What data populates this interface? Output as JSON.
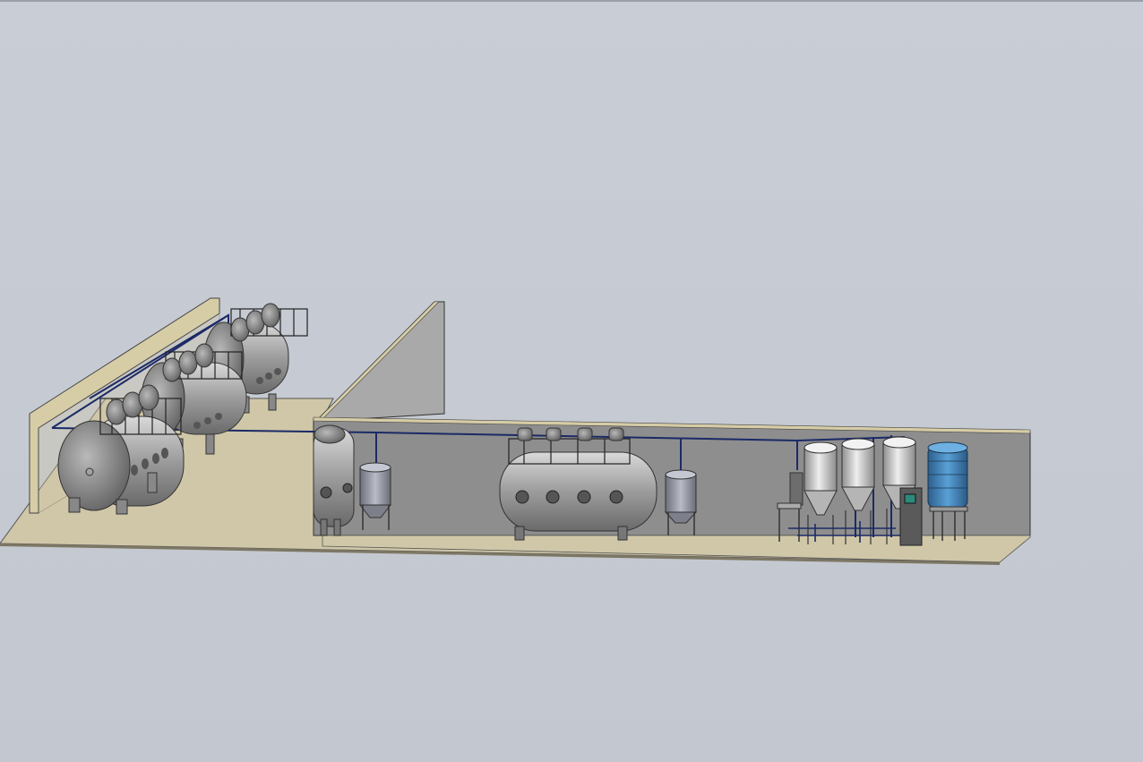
{
  "viewport": {
    "background": "#c4c8d0",
    "floor_color": "#cfc7a8",
    "wall_color": "#8e8e8e",
    "wall_top_color": "#d6cca6",
    "pipe_color": "#1b2a66",
    "steel_color": "#a7a7a7",
    "water_tank_color": "#3f7fb5"
  },
  "scene": {
    "autoclaves": 3,
    "mid_wall_tanks": 2,
    "small_mixers": 2,
    "conical_fermenters": 3,
    "blue_water_tank": 1
  }
}
